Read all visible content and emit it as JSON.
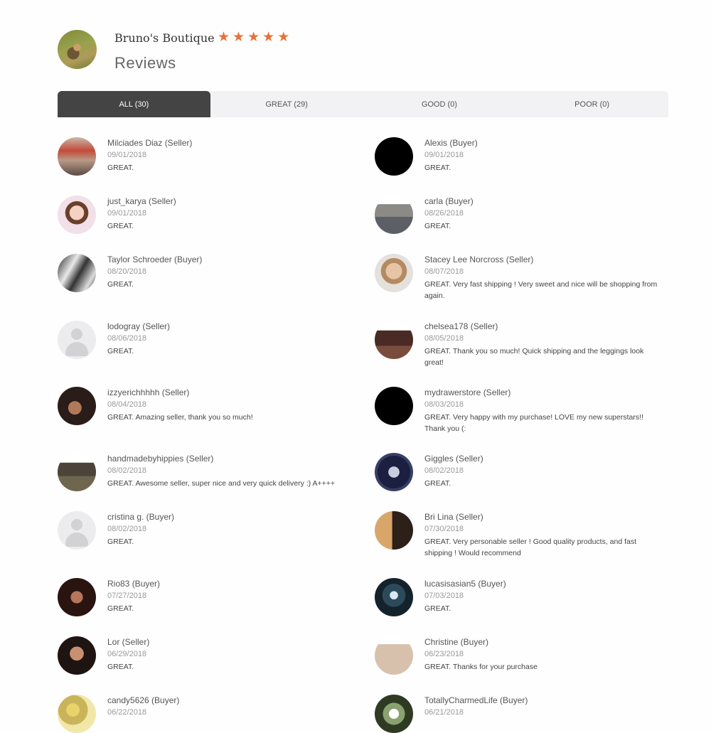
{
  "shop": {
    "name": "Bruno's Boutique",
    "rating": 5,
    "rating_max": 5,
    "star_color": "#e6733a",
    "title": "Reviews"
  },
  "tabs": [
    {
      "label": "ALL (30)",
      "active": true
    },
    {
      "label": "GREAT (29)",
      "active": false
    },
    {
      "label": "GOOD (0)",
      "active": false
    },
    {
      "label": "POOR (0)",
      "active": false
    }
  ],
  "reviews": [
    {
      "name": "Milciades Diaz (Seller)",
      "date": "09/01/2018",
      "text": "GREAT.",
      "avatar": "photo"
    },
    {
      "name": "Alexis (Buyer)",
      "date": "09/01/2018",
      "text": "GREAT.",
      "avatar": "black"
    },
    {
      "name": "just_karya (Seller)",
      "date": "09/01/2018",
      "text": "GREAT.",
      "avatar": "photo"
    },
    {
      "name": "carla (Buyer)",
      "date": "08/26/2018",
      "text": "GREAT.",
      "avatar": "photo"
    },
    {
      "name": "Taylor Schroeder (Buyer)",
      "date": "08/20/2018",
      "text": "GREAT.",
      "avatar": "photo"
    },
    {
      "name": "Stacey Lee Norcross (Seller)",
      "date": "08/07/2018",
      "text": "GREAT. Very fast shipping ! Very sweet and nice will be shopping from again.",
      "avatar": "photo"
    },
    {
      "name": "lodogray (Seller)",
      "date": "08/06/2018",
      "text": "GREAT.",
      "avatar": "default"
    },
    {
      "name": "chelsea178 (Seller)",
      "date": "08/05/2018",
      "text": "GREAT. Thank you so much! Quick shipping and the leggings look great!",
      "avatar": "photo"
    },
    {
      "name": "izzyerichhhhh (Seller)",
      "date": "08/04/2018",
      "text": "GREAT. Amazing seller, thank you so much!",
      "avatar": "photo"
    },
    {
      "name": "mydrawerstore (Seller)",
      "date": "08/03/2018",
      "text": "GREAT. Very happy with my purchase! LOVE my new superstars!! Thank you (:",
      "avatar": "black"
    },
    {
      "name": "handmadebyhippies (Seller)",
      "date": "08/02/2018",
      "text": "GREAT. Awesome seller, super nice and very quick delivery :) A++++",
      "avatar": "photo"
    },
    {
      "name": "Giggles (Seller)",
      "date": "08/02/2018",
      "text": "GREAT.",
      "avatar": "photo"
    },
    {
      "name": "cristina g. (Buyer)",
      "date": "08/02/2018",
      "text": "GREAT.",
      "avatar": "default"
    },
    {
      "name": "Bri Lina (Seller)",
      "date": "07/30/2018",
      "text": "GREAT. Very personable seller ! Good quality products, and fast shipping ! Would recommend",
      "avatar": "photo"
    },
    {
      "name": "Rio83 (Buyer)",
      "date": "07/27/2018",
      "text": "GREAT.",
      "avatar": "photo"
    },
    {
      "name": "lucasisasian5 (Buyer)",
      "date": "07/03/2018",
      "text": "GREAT.",
      "avatar": "photo"
    },
    {
      "name": "Lor (Seller)",
      "date": "06/29/2018",
      "text": "GREAT.",
      "avatar": "photo"
    },
    {
      "name": "Christine (Buyer)",
      "date": "06/23/2018",
      "text": "GREAT. Thanks for your purchase",
      "avatar": "photo"
    },
    {
      "name": "candy5626 (Buyer)",
      "date": "06/22/2018",
      "text": "",
      "avatar": "photo"
    },
    {
      "name": "TotallyCharmedLife (Buyer)",
      "date": "06/21/2018",
      "text": "",
      "avatar": "photo"
    }
  ]
}
